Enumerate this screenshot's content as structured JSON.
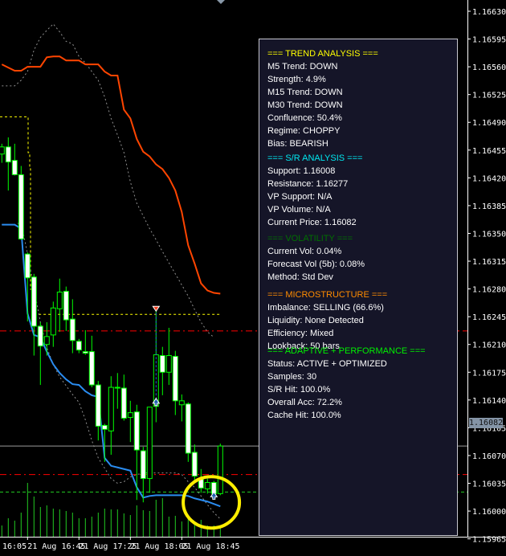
{
  "panel": {
    "trend": {
      "header": "=== TREND ANALYSIS ===",
      "items": [
        "M5 Trend: DOWN",
        "Strength: 4.9%",
        "M15 Trend: DOWN",
        "M30 Trend: DOWN",
        "Confluence: 50.4%",
        "Regime: CHOPPY",
        "Bias: BEARISH"
      ]
    },
    "sr": {
      "header": "=== S/R ANALYSIS ===",
      "items": [
        "Support: 1.16008",
        "Resistance: 1.16277",
        "VP Support: N/A",
        "VP Volume: N/A",
        "Current Price: 1.16082"
      ]
    },
    "volatility": {
      "header": "=== VOLATILITY ===",
      "items": [
        "Current Vol: 0.04%",
        "Forecast Vol (5b): 0.08%",
        "Method: Std Dev"
      ]
    },
    "micro": {
      "header": "=== MICROSTRUCTURE ===",
      "items": [
        "Imbalance: SELLING (66.6%)",
        "Liquidity: None Detected",
        "Efficiency: Mixed",
        "Lookback: 50 bars"
      ]
    },
    "adaptive": {
      "header": "=== ADAPTIVE + PERFORMANCE ===",
      "items": [
        "Status: ACTIVE + OPTIMIZED",
        "Samples: 30",
        "S/R Hit: 100.0%",
        "Overall Acc: 72.2%",
        "Cache Hit: 100.0%"
      ]
    }
  },
  "current_price_label": "1.16082",
  "colors": {
    "candle": "#00ff00",
    "upper_band": "#ff4500",
    "lower_line": "#2a8cf0",
    "band_gray": "#909090",
    "resistance": "#ff0000",
    "support": "#22cc22",
    "level_box": "#ffff00",
    "highlight": "#ffee00",
    "panel_bg": "#151528"
  },
  "chart_data": {
    "type": "candlestick",
    "symbol_timeframe": "M5",
    "price_axis": {
      "max": 1.1663,
      "min": 1.15965,
      "step": 0.00035,
      "labels": [
        "1.16630",
        "1.16595",
        "1.16560",
        "1.16525",
        "1.16490",
        "1.16455",
        "1.16420",
        "1.16385",
        "1.16350",
        "1.16315",
        "1.16280",
        "1.16245",
        "1.16210",
        "1.16175",
        "1.16140",
        "1.16105",
        "1.16070",
        "1.16035",
        "1.16000",
        "1.15965"
      ]
    },
    "time_axis": [
      {
        "bar": 0,
        "label": "16:05"
      },
      {
        "bar": 4,
        "label": "21 Aug 16:45"
      },
      {
        "bar": 12,
        "label": "21 Aug 17:25"
      },
      {
        "bar": 20,
        "label": "21 Aug 18:05"
      },
      {
        "bar": 28,
        "label": "21 Aug 18:45"
      }
    ],
    "ohlc": [
      [
        1.1645,
        1.16463,
        1.16439,
        1.16459
      ],
      [
        1.16459,
        1.16471,
        1.16404,
        1.1644
      ],
      [
        1.16442,
        1.16463,
        1.16423,
        1.16424
      ],
      [
        1.16424,
        1.16435,
        1.16342,
        1.16343
      ],
      [
        1.16324,
        1.16326,
        1.16239,
        1.16294
      ],
      [
        1.16295,
        1.16299,
        1.16196,
        1.16233
      ],
      [
        1.16233,
        1.16238,
        1.16159,
        1.16208
      ],
      [
        1.1621,
        1.16238,
        1.16196,
        1.1622
      ],
      [
        1.16222,
        1.16264,
        1.16207,
        1.16256
      ],
      [
        1.16255,
        1.16293,
        1.16226,
        1.16276
      ],
      [
        1.16277,
        1.16283,
        1.16227,
        1.16241
      ],
      [
        1.16242,
        1.16267,
        1.16199,
        1.16215
      ],
      [
        1.16214,
        1.16217,
        1.16199,
        1.16203
      ],
      [
        1.16201,
        1.16228,
        1.16197,
        1.16199
      ],
      [
        1.16201,
        1.16221,
        1.16156,
        1.16159
      ],
      [
        1.16159,
        1.16164,
        1.16089,
        1.16107
      ],
      [
        1.16108,
        1.1611,
        1.16062,
        1.16103
      ],
      [
        1.16101,
        1.1617,
        1.16071,
        1.16156
      ],
      [
        1.16156,
        1.16174,
        1.16129,
        1.16155
      ],
      [
        1.16155,
        1.16172,
        1.16114,
        1.16117
      ],
      [
        1.16118,
        1.16139,
        1.16087,
        1.16124
      ],
      [
        1.16125,
        1.16134,
        1.16014,
        1.16077
      ],
      [
        1.16076,
        1.16081,
        1.16011,
        1.16041
      ],
      [
        1.16041,
        1.16131,
        1.16023,
        1.16131
      ],
      [
        1.16132,
        1.16258,
        1.16112,
        1.16197
      ],
      [
        1.16196,
        1.16207,
        1.16146,
        1.16175
      ],
      [
        1.16175,
        1.16231,
        1.16159,
        1.16196
      ],
      [
        1.16195,
        1.16202,
        1.16121,
        1.16139
      ],
      [
        1.16134,
        1.16147,
        1.16113,
        1.16139
      ],
      [
        1.16135,
        1.16137,
        1.16062,
        1.16073
      ],
      [
        1.16074,
        1.16084,
        1.16036,
        1.16044
      ],
      [
        1.1604,
        1.16053,
        1.16023,
        1.16029
      ],
      [
        1.16028,
        1.16041,
        1.16022,
        1.16036
      ],
      [
        1.16036,
        1.16038,
        1.16019,
        1.16022
      ],
      [
        1.16022,
        1.16085,
        1.1602,
        1.16082
      ]
    ],
    "volume": [
      14,
      23,
      20,
      30,
      67,
      50,
      37,
      39,
      35,
      34,
      32,
      30,
      23,
      23,
      25,
      30,
      35,
      34,
      34,
      29,
      27,
      39,
      33,
      32,
      46,
      48,
      25,
      26,
      19,
      25,
      19,
      21,
      14,
      14,
      13
    ],
    "upper_band": [
      1.16563,
      1.16559,
      1.16555,
      1.16555,
      1.1656,
      1.1656,
      1.1656,
      1.16572,
      1.16573,
      1.16573,
      1.16568,
      1.16568,
      1.16568,
      1.16563,
      1.16563,
      1.16563,
      1.16554,
      1.16549,
      1.16549,
      1.16506,
      1.16495,
      1.16469,
      1.16453,
      1.16447,
      1.16437,
      1.16431,
      1.1642,
      1.16404,
      1.16377,
      1.16335,
      1.16312,
      1.16287,
      1.16278,
      1.16275,
      1.16274
    ],
    "gray_upper": [
      1.16536,
      1.16536,
      1.16536,
      1.16543,
      1.16554,
      1.16581,
      1.16597,
      1.16606,
      1.16614,
      1.16604,
      1.16592,
      1.16589,
      1.16573,
      1.16565,
      1.16554,
      1.16543,
      1.16522,
      1.16495,
      1.16474,
      1.16452,
      1.16415,
      1.16388,
      1.16372,
      1.16356,
      1.16342,
      1.16327,
      1.16313,
      1.16299,
      1.16285,
      1.16271,
      1.16254,
      1.16238,
      1.16226,
      1.16219
    ],
    "gray_lower": [
      1.16361,
      1.16361,
      1.16361,
      1.16364,
      1.16324,
      1.16281,
      1.16238,
      1.16206,
      1.16185,
      1.16169,
      1.16158,
      1.16147,
      1.16137,
      1.16115,
      1.16089,
      1.16067,
      1.16054,
      1.16041,
      1.16035,
      1.16037,
      1.16043,
      1.16046,
      1.16048,
      1.16048,
      1.16048,
      1.16048,
      1.16048,
      1.16048,
      1.16046,
      1.16037,
      1.1603,
      1.16019,
      1.16008,
      1.15998,
      1.1599
    ],
    "blue_line": [
      1.16361,
      1.16361,
      1.16361,
      1.16356,
      1.16249,
      1.16222,
      1.16219,
      1.16201,
      1.16185,
      1.16174,
      1.16166,
      1.1616,
      1.16159,
      1.16151,
      1.16146,
      1.16144,
      1.16067,
      1.16057,
      1.16055,
      1.16053,
      1.16051,
      1.1603,
      1.16017,
      1.16019,
      1.1602,
      1.1602,
      1.1602,
      1.1602,
      1.1602,
      1.16019,
      1.16016,
      1.16014,
      1.16012,
      1.16009,
      1.16006
    ],
    "levels": {
      "current": 1.16082,
      "red_upper": 1.16227,
      "red_lower": 1.16046,
      "green_support": 1.16024,
      "yellow_box_top": 1.16497,
      "yellow_box_bottom": 1.16248
    },
    "signals": [
      {
        "type": "sell-arrow",
        "bar": 24,
        "price": 1.16255
      },
      {
        "type": "buy-arrow",
        "bar": 24,
        "price": 1.16138
      },
      {
        "type": "buy-arrow",
        "bar": 33,
        "price": 1.1602
      }
    ],
    "highlight_circle": {
      "bar": 32.6,
      "price": 1.16011
    }
  }
}
